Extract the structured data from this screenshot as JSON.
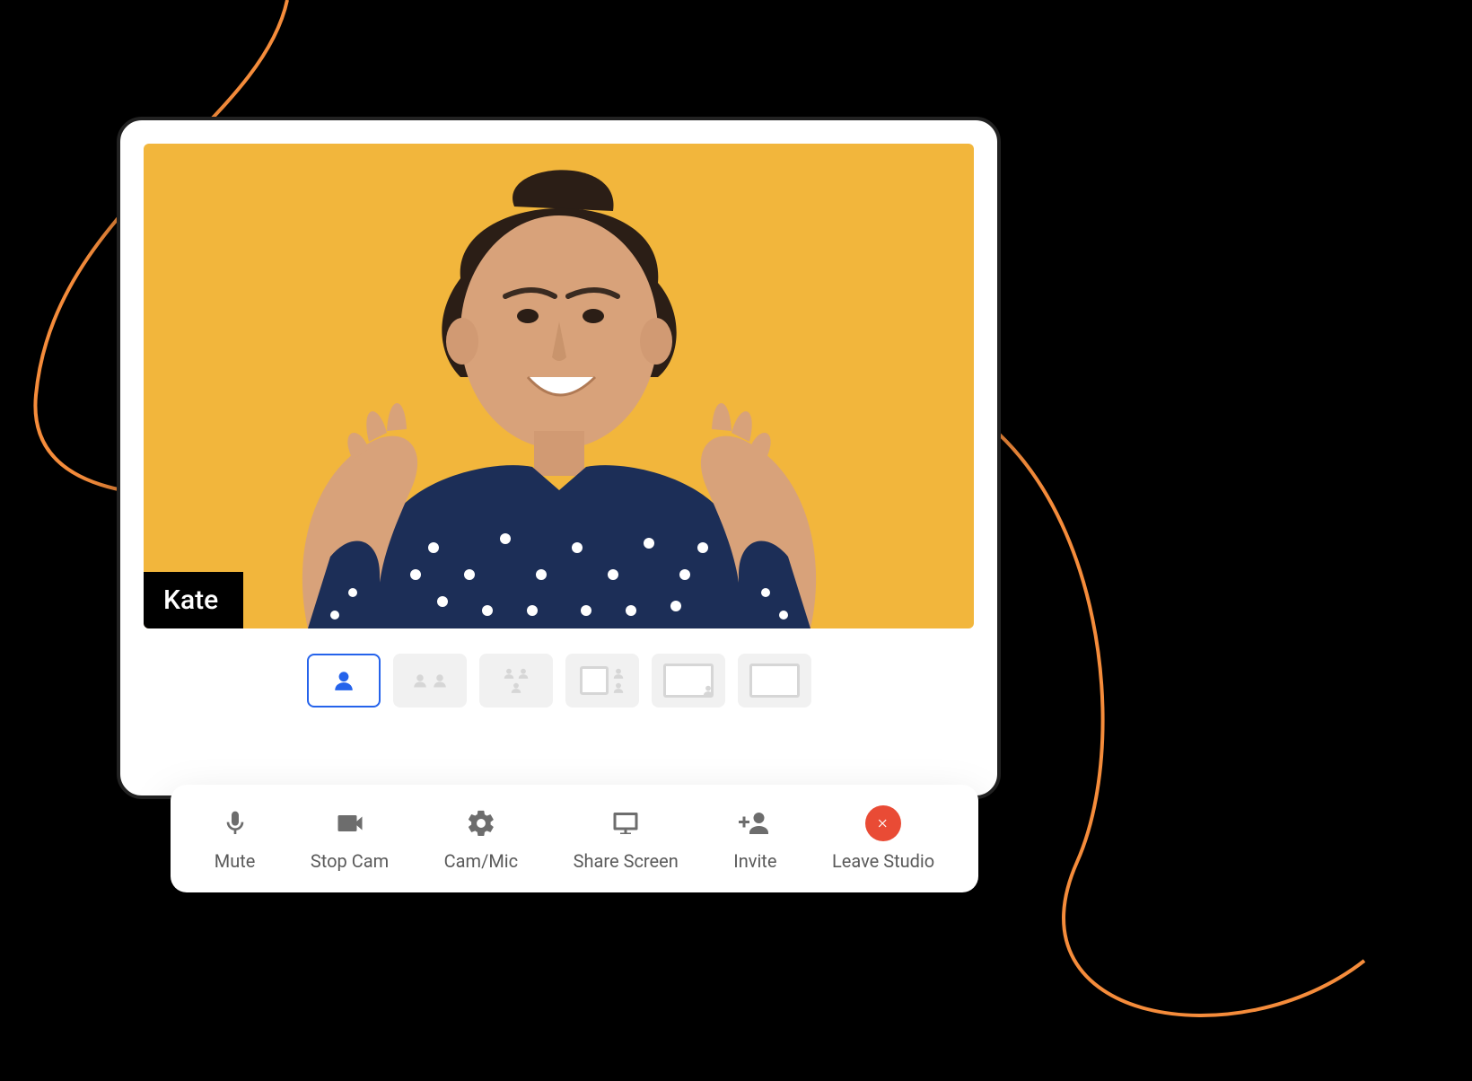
{
  "participant": {
    "name": "Kate"
  },
  "video_bg_color": "#f2b63c",
  "accent_color": "#2563eb",
  "leave_color": "#e94b35",
  "layouts": {
    "active_index": 0,
    "options": [
      "single",
      "two-up",
      "three-up",
      "screen-left-people-right",
      "screen-with-pip",
      "screen-only"
    ]
  },
  "toolbar": {
    "mute": "Mute",
    "stop_cam": "Stop Cam",
    "cam_mic": "Cam/Mic",
    "share_screen": "Share Screen",
    "invite": "Invite",
    "leave": "Leave Studio"
  }
}
